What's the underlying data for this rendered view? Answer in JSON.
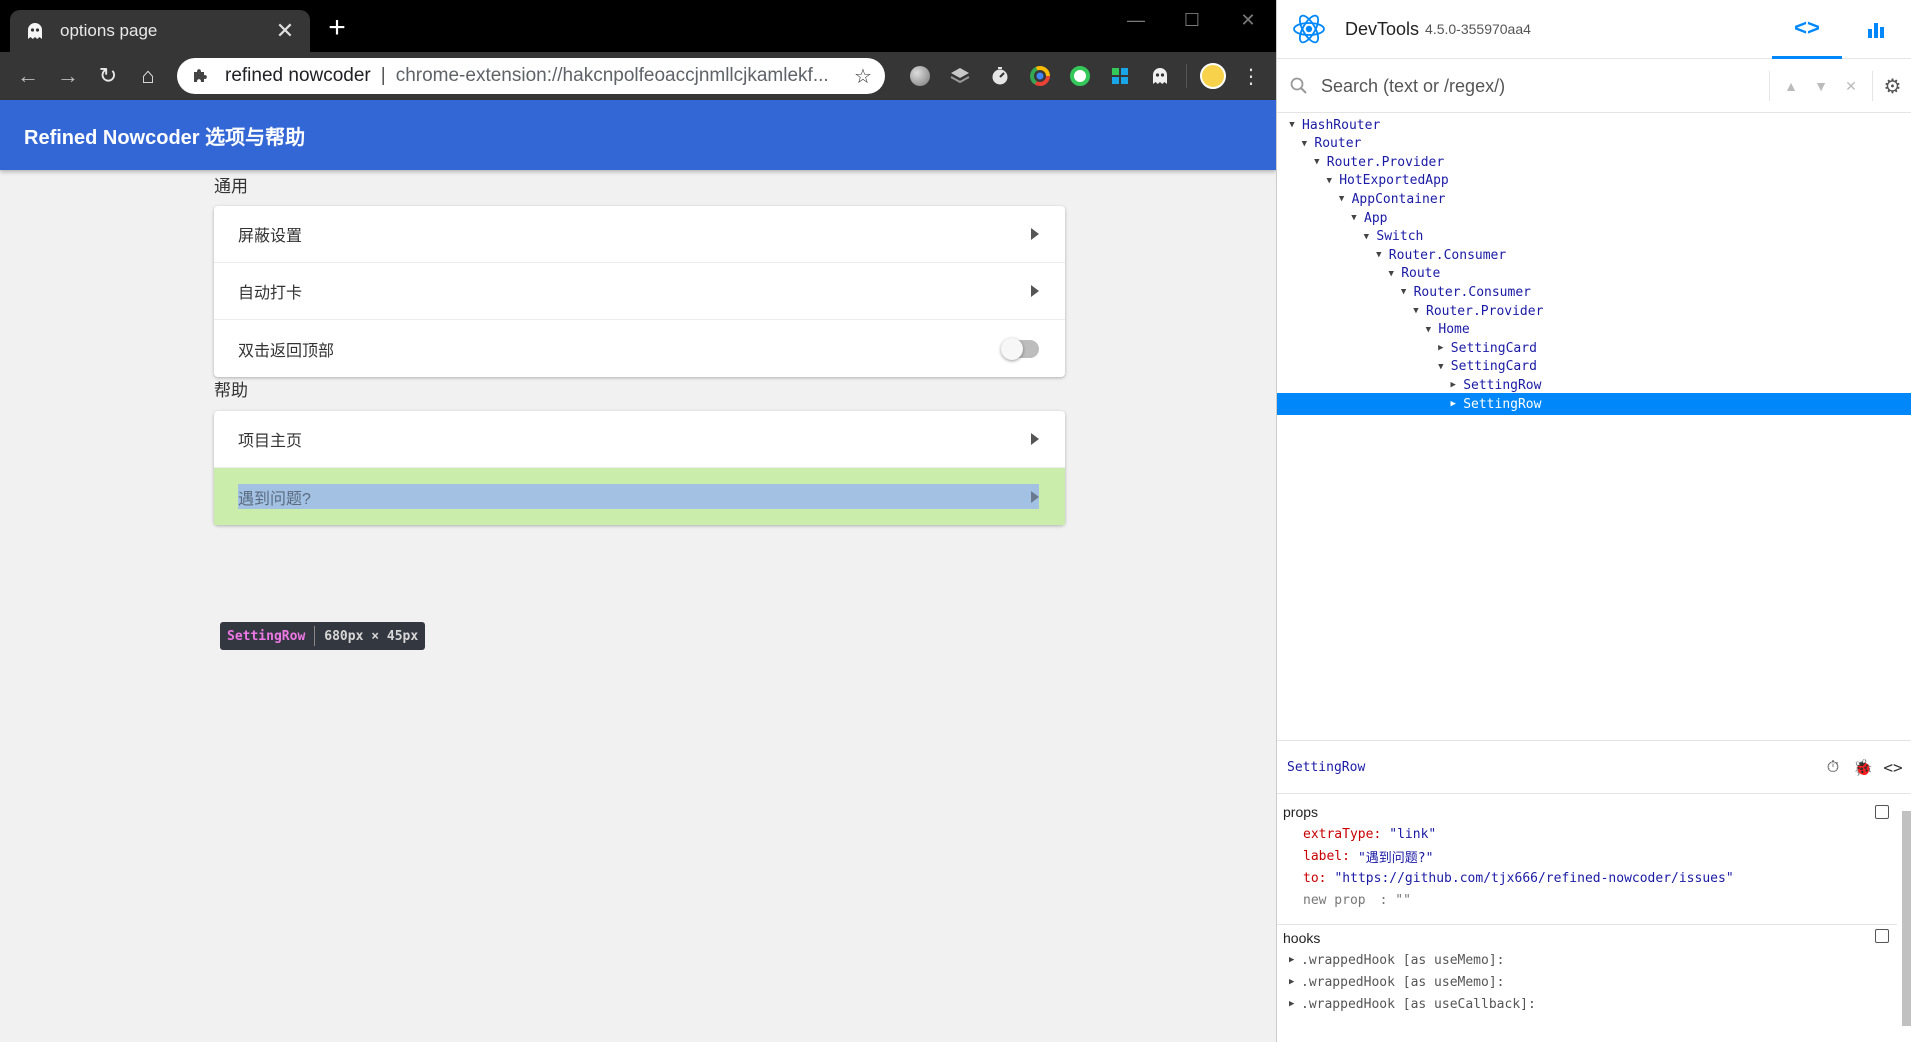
{
  "browser": {
    "tab": {
      "title": "options page",
      "close": "✕"
    },
    "new_tab": "+",
    "window": {
      "minimize": "—",
      "maximize": "☐",
      "close": "✕"
    },
    "nav": {
      "back": "←",
      "forward": "→",
      "reload": "↻",
      "home": "⌂"
    },
    "omnibox": {
      "site": "refined nowcoder",
      "separator": "|",
      "url": "chrome-extension://hakcnpolfeoaccjnmllcjkamlekf..."
    },
    "extensions": [
      {
        "name": "extension-globe-icon",
        "color": "#9e9e9e"
      },
      {
        "name": "extension-layers-icon",
        "color": "#b0b0b0"
      },
      {
        "name": "extension-timer-icon",
        "color": "#d8d8d8"
      },
      {
        "name": "extension-chrome-ring-icon",
        "color": "#4285f4"
      },
      {
        "name": "extension-green-ring-icon",
        "color": "#34c759"
      },
      {
        "name": "extension-puzzle-tiles-icon",
        "color": "#1aa5e8"
      },
      {
        "name": "extension-ghost-icon",
        "color": "#f0f0f0"
      }
    ]
  },
  "page": {
    "header_title": "Refined Nowcoder 选项与帮助",
    "sections": [
      {
        "title": "通用",
        "rows": [
          {
            "label": "屏蔽设置",
            "control": "arrow"
          },
          {
            "label": "自动打卡",
            "control": "arrow"
          },
          {
            "label": "双击返回顶部",
            "control": "toggle",
            "toggle_on": false
          }
        ]
      },
      {
        "title": "帮助",
        "rows": [
          {
            "label": "项目主页",
            "control": "arrow"
          },
          {
            "label": "遇到问题?",
            "control": "arrow",
            "highlighted": true
          }
        ]
      }
    ],
    "inspect_tooltip": {
      "component": "SettingRow",
      "size": "680px × 45px"
    }
  },
  "devtools": {
    "title": "DevTools",
    "version": "4.5.0-355970aa4",
    "tabs": {
      "components": "<>",
      "profiler": "▮▮"
    },
    "search_placeholder": "Search (text or /regex/)",
    "tree": [
      {
        "name": "HashRouter",
        "depth": 0,
        "expanded": true
      },
      {
        "name": "Router",
        "depth": 1,
        "expanded": true
      },
      {
        "name": "Router.Provider",
        "depth": 2,
        "expanded": true
      },
      {
        "name": "HotExportedApp",
        "depth": 3,
        "expanded": true
      },
      {
        "name": "AppContainer",
        "depth": 4,
        "expanded": true
      },
      {
        "name": "App",
        "depth": 5,
        "expanded": true
      },
      {
        "name": "Switch",
        "depth": 6,
        "expanded": true
      },
      {
        "name": "Router.Consumer",
        "depth": 7,
        "expanded": true
      },
      {
        "name": "Route",
        "depth": 8,
        "expanded": true
      },
      {
        "name": "Router.Consumer",
        "depth": 9,
        "expanded": true
      },
      {
        "name": "Router.Provider",
        "depth": 10,
        "expanded": true
      },
      {
        "name": "Home",
        "depth": 11,
        "expanded": true
      },
      {
        "name": "SettingCard",
        "depth": 12,
        "expanded": false
      },
      {
        "name": "SettingCard",
        "depth": 12,
        "expanded": true
      },
      {
        "name": "SettingRow",
        "depth": 13,
        "expanded": false
      },
      {
        "name": "SettingRow",
        "depth": 13,
        "expanded": false,
        "selected": true
      }
    ],
    "selected": {
      "name": "SettingRow",
      "props_label": "props",
      "props": [
        {
          "key": "extraType",
          "value": "\"link\""
        },
        {
          "key": "label",
          "value": "\"遇到问题?\""
        },
        {
          "key": "to",
          "value": "\"https://github.com/tjx666/refined-nowcoder/issues\""
        }
      ],
      "new_prop": {
        "key": "new prop",
        "value": ": \"\""
      },
      "hooks_label": "hooks",
      "hooks": [
        ".wrappedHook [as useMemo]:",
        ".wrappedHook [as useMemo]:",
        ".wrappedHook [as useCallback]:"
      ]
    },
    "colors": {
      "accent": "#0088fa",
      "component": "#1a1aa6",
      "prop_key": "#c80000"
    }
  }
}
